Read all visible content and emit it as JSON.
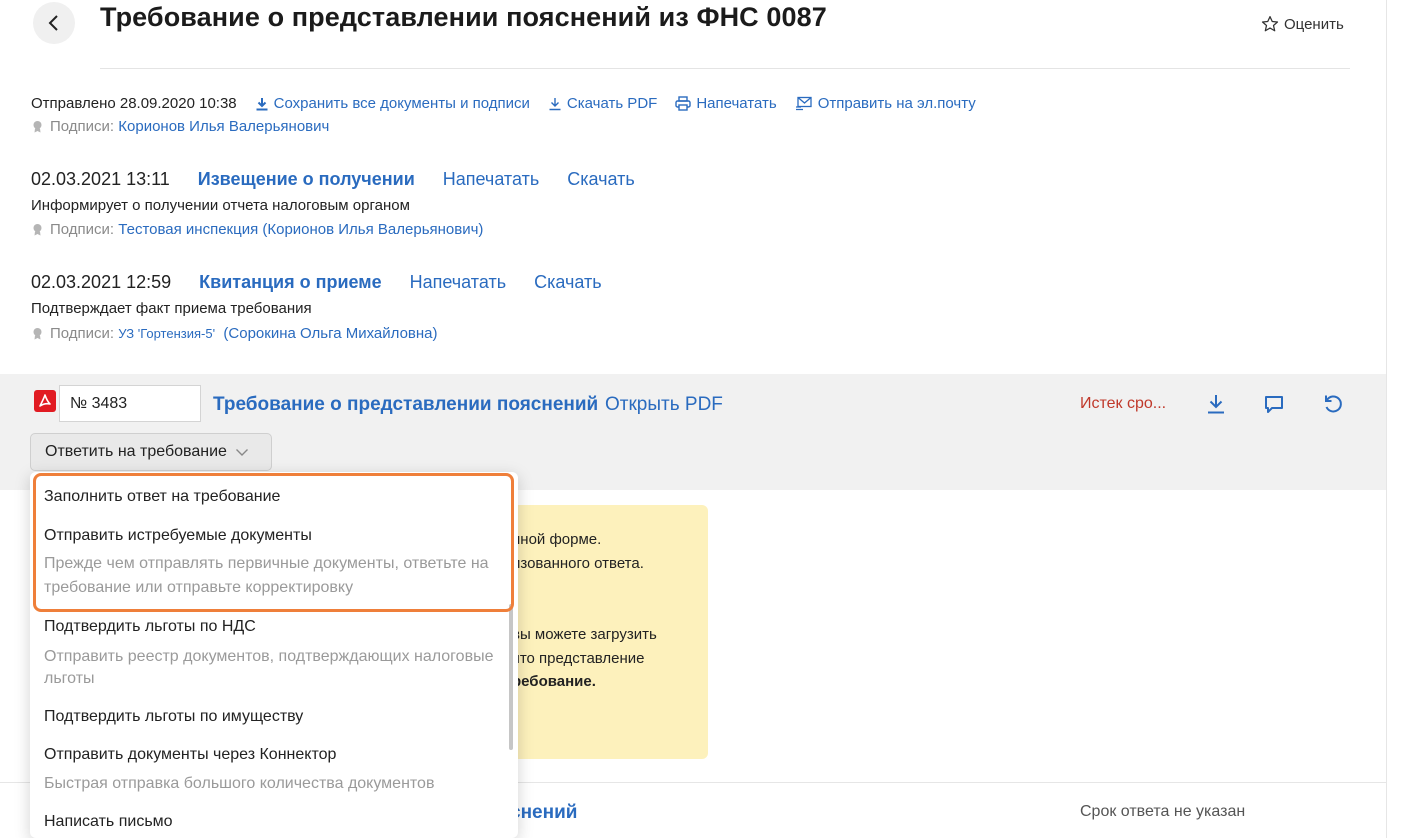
{
  "header": {
    "title": "Требование о представлении пояснений из ФНС 0087",
    "rate_label": "Оценить"
  },
  "sent": {
    "text": "Отправлено 28.09.2020 10:38",
    "actions": [
      {
        "icon": "download-icon",
        "label": "Сохранить все документы и подписи"
      },
      {
        "icon": "download-icon",
        "label": "Скачать PDF"
      },
      {
        "icon": "printer-icon",
        "label": "Напечатать"
      },
      {
        "icon": "mail-icon",
        "label": "Отправить на эл.почту"
      }
    ],
    "signatures_label": "Подписи:",
    "signatures_value": "Корионов Илья Валерьянович"
  },
  "events": [
    {
      "datetime": "02.03.2021 13:11",
      "title": "Извещение о получении",
      "print": "Напечатать",
      "download": "Скачать",
      "description": "Информирует о получении отчета налоговым органом",
      "signatures_label": "Подписи:",
      "signatures_value": "Тестовая инспекция (Корионов Илья Валерьянович)"
    },
    {
      "datetime": "02.03.2021 12:59",
      "title": "Квитанция о приеме",
      "print": "Напечатать",
      "download": "Скачать",
      "description": "Подтверждает факт приема требования",
      "signatures_label": "Подписи:",
      "signatures_org": "УЗ 'Гортензия-5'",
      "signatures_value": "(Сорокина Ольга Михайловна)"
    }
  ],
  "requirement": {
    "number_value": "№ 3483",
    "title": "Требование о представлении пояснений",
    "open_pdf": "Открыть PDF",
    "status": "Истек сро...",
    "reply_button": "Ответить на требование"
  },
  "note": {
    "lines": [
      "нной форме.",
      "изованного ответа.",
      "вы можете загрузить",
      "что представление",
      "ребование."
    ]
  },
  "dropdown": {
    "items": [
      {
        "label": "Заполнить ответ на требование"
      },
      {
        "label": "Отправить истребуемые документы",
        "hint": [
          "Прежде чем отправлять первичные документы, ответьте на",
          "требование или отправьте корректировку"
        ]
      },
      {
        "label": "Подтвердить льготы по НДС",
        "hint": [
          "Отправить реестр документов, подтверждающих налоговые",
          "льготы"
        ]
      },
      {
        "label": "Подтвердить льготы по имуществу"
      },
      {
        "label": "Отправить документы через Коннектор",
        "hint": [
          "Быстрая отправка большого количества документов"
        ]
      },
      {
        "label": "Написать письмо"
      }
    ]
  },
  "bottom": {
    "title_fragment": "снений",
    "deadline": "Срок ответа не указан"
  },
  "colors": {
    "link": "#2a6bbf",
    "expired": "#c0392b",
    "highlight": "#ef7f3a",
    "note_bg": "#fdf1bc"
  }
}
